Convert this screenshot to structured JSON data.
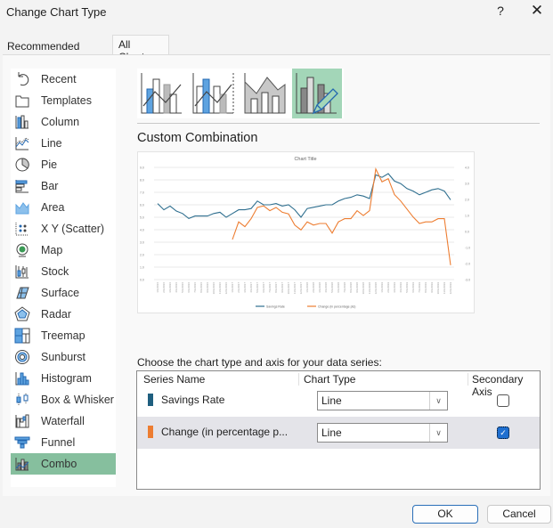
{
  "window": {
    "title": "Change Chart Type",
    "help_label": "?",
    "close_label": "✕"
  },
  "tabs": [
    {
      "label": "Recommended Charts",
      "selected": false
    },
    {
      "label": "All Charts",
      "selected": true
    }
  ],
  "sidebar": {
    "items": [
      {
        "label": "Recent",
        "icon": "undo-icon"
      },
      {
        "label": "Templates",
        "icon": "folder-icon"
      },
      {
        "label": "Column",
        "icon": "column-chart-icon"
      },
      {
        "label": "Line",
        "icon": "line-chart-icon"
      },
      {
        "label": "Pie",
        "icon": "pie-chart-icon"
      },
      {
        "label": "Bar",
        "icon": "bar-chart-icon"
      },
      {
        "label": "Area",
        "icon": "area-chart-icon"
      },
      {
        "label": "X Y (Scatter)",
        "icon": "scatter-chart-icon"
      },
      {
        "label": "Map",
        "icon": "map-chart-icon"
      },
      {
        "label": "Stock",
        "icon": "stock-chart-icon"
      },
      {
        "label": "Surface",
        "icon": "surface-chart-icon"
      },
      {
        "label": "Radar",
        "icon": "radar-chart-icon"
      },
      {
        "label": "Treemap",
        "icon": "treemap-chart-icon"
      },
      {
        "label": "Sunburst",
        "icon": "sunburst-chart-icon"
      },
      {
        "label": "Histogram",
        "icon": "histogram-chart-icon"
      },
      {
        "label": "Box & Whisker",
        "icon": "box-whisker-chart-icon"
      },
      {
        "label": "Waterfall",
        "icon": "waterfall-chart-icon"
      },
      {
        "label": "Funnel",
        "icon": "funnel-chart-icon"
      },
      {
        "label": "Combo",
        "icon": "combo-chart-icon",
        "selected": true
      }
    ]
  },
  "subtypes": [
    {
      "name": "clustered-column-line",
      "selected": false
    },
    {
      "name": "clustered-column-line-secondary-axis",
      "selected": false
    },
    {
      "name": "stacked-area-clustered-column",
      "selected": false
    },
    {
      "name": "custom-combination",
      "selected": true
    }
  ],
  "section_title": "Custom Combination",
  "chart_data": {
    "type": "line",
    "title": "Chart Title",
    "x": [
      "1/1/2016",
      "2/1/2016",
      "3/1/2016",
      "4/1/2016",
      "5/1/2016",
      "6/1/2016",
      "7/1/2016",
      "8/1/2016",
      "9/1/2016",
      "10/1/2016",
      "11/1/2016",
      "12/1/2016",
      "1/1/2017",
      "2/1/2017",
      "3/1/2017",
      "4/1/2017",
      "5/1/2017",
      "6/1/2017",
      "7/1/2017",
      "8/1/2017",
      "9/1/2017",
      "10/1/2017",
      "11/1/2017",
      "12/1/2017",
      "1/1/2018",
      "2/1/2018",
      "3/1/2018",
      "4/1/2018",
      "5/1/2018",
      "6/1/2018",
      "7/1/2018",
      "8/1/2018",
      "9/1/2018",
      "10/1/2018",
      "11/1/2018",
      "12/1/2018",
      "1/1/2019",
      "2/1/2019",
      "3/1/2019",
      "4/1/2019",
      "5/1/2019",
      "6/1/2019",
      "7/1/2019",
      "8/1/2019",
      "9/1/2019",
      "10/1/2019",
      "11/1/2019",
      "12/1/2019"
    ],
    "series": [
      {
        "name": "Savings Rate",
        "axis": "primary",
        "color": "#2f6f8f",
        "values": [
          6.1,
          5.6,
          5.9,
          5.5,
          5.3,
          4.9,
          5.1,
          5.1,
          5.1,
          5.3,
          5.4,
          5.0,
          5.3,
          5.6,
          5.6,
          5.7,
          6.3,
          6.0,
          6.0,
          6.1,
          5.9,
          6.0,
          5.6,
          5.0,
          5.7,
          5.8,
          5.9,
          6.0,
          6.0,
          6.3,
          6.5,
          6.6,
          6.8,
          6.7,
          6.5,
          8.4,
          8.2,
          8.5,
          7.9,
          7.7,
          7.3,
          7.1,
          6.8,
          7.0,
          7.2,
          7.3,
          7.1,
          6.4
        ]
      },
      {
        "name": "Change (in percentage pts)",
        "axis": "secondary",
        "color": "#ed7d31",
        "values": [
          null,
          null,
          null,
          null,
          null,
          null,
          null,
          null,
          null,
          null,
          null,
          null,
          -0.5,
          0.6,
          0.3,
          0.8,
          1.5,
          1.6,
          1.3,
          1.5,
          1.2,
          1.1,
          0.4,
          0.1,
          0.6,
          0.4,
          0.5,
          0.5,
          -0.1,
          0.6,
          0.8,
          0.8,
          1.3,
          1.0,
          1.3,
          3.9,
          3.1,
          3.3,
          2.3,
          1.9,
          1.4,
          0.9,
          0.5,
          0.6,
          0.6,
          0.8,
          0.8,
          -2.1
        ]
      }
    ],
    "y_primary": {
      "min": 0,
      "max": 9,
      "ticks": [
        "0.0",
        "1.0",
        "2.0",
        "3.0",
        "4.0",
        "5.0",
        "6.0",
        "7.0",
        "8.0",
        "9.0"
      ]
    },
    "y_secondary": {
      "min": -3,
      "max": 4,
      "ticks": [
        "-3.0",
        "-2.0",
        "-1.0",
        "0.0",
        "1.0",
        "2.0",
        "3.0",
        "4.0"
      ]
    },
    "legend": [
      "Savings Rate",
      "Change (in percentage pts)"
    ],
    "legend_position": "bottom",
    "grid": true
  },
  "series_table": {
    "prompt": "Choose the chart type and axis for your data series:",
    "headers": [
      "Series Name",
      "Chart Type",
      "Secondary Axis"
    ],
    "rows": [
      {
        "name": "Savings Rate",
        "color": "#1f5f7f",
        "chart_type": "Line",
        "secondary_axis": false,
        "selected": false
      },
      {
        "name": "Change (in percentage p...",
        "color": "#ed7d31",
        "chart_type": "Line",
        "secondary_axis": true,
        "selected": true
      }
    ]
  },
  "buttons": {
    "ok": "OK",
    "cancel": "Cancel"
  }
}
